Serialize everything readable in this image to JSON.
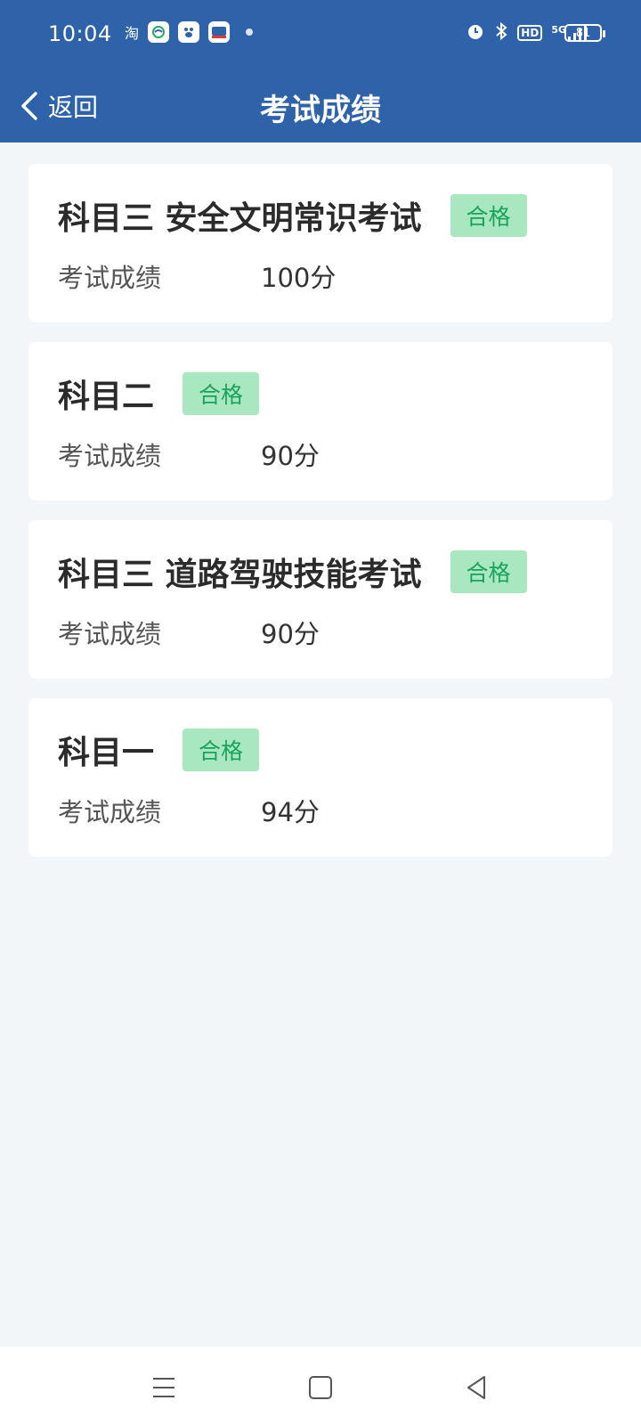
{
  "status_bar": {
    "time": "10:04",
    "notification_icons": [
      "taobao-icon",
      "china-mobile-icon",
      "baidu-icon",
      "ticket-app-icon",
      "dot-icon"
    ],
    "taobao_text": "淘",
    "system_icons": [
      "alarm-icon",
      "bluetooth-icon",
      "hd-icon",
      "5g-signal-icon"
    ],
    "hd_text": "HD",
    "network_text": "5G",
    "battery": "81"
  },
  "header": {
    "back_label": "返回",
    "title": "考试成绩"
  },
  "colors": {
    "header_bg": "#2e63a9",
    "badge_bg": "#a9e7c1",
    "badge_text": "#1aa35a",
    "page_bg": "#f3f6f9"
  },
  "results": [
    {
      "subject": "科目三 安全文明常识考试",
      "status": "合格",
      "score_label": "考试成绩",
      "score": "100分"
    },
    {
      "subject": "科目二",
      "status": "合格",
      "score_label": "考试成绩",
      "score": "90分"
    },
    {
      "subject": "科目三 道路驾驶技能考试",
      "status": "合格",
      "score_label": "考试成绩",
      "score": "90分"
    },
    {
      "subject": "科目一",
      "status": "合格",
      "score_label": "考试成绩",
      "score": "94分"
    }
  ],
  "system_nav": [
    "menu-icon",
    "home-icon",
    "back-triangle-icon"
  ]
}
